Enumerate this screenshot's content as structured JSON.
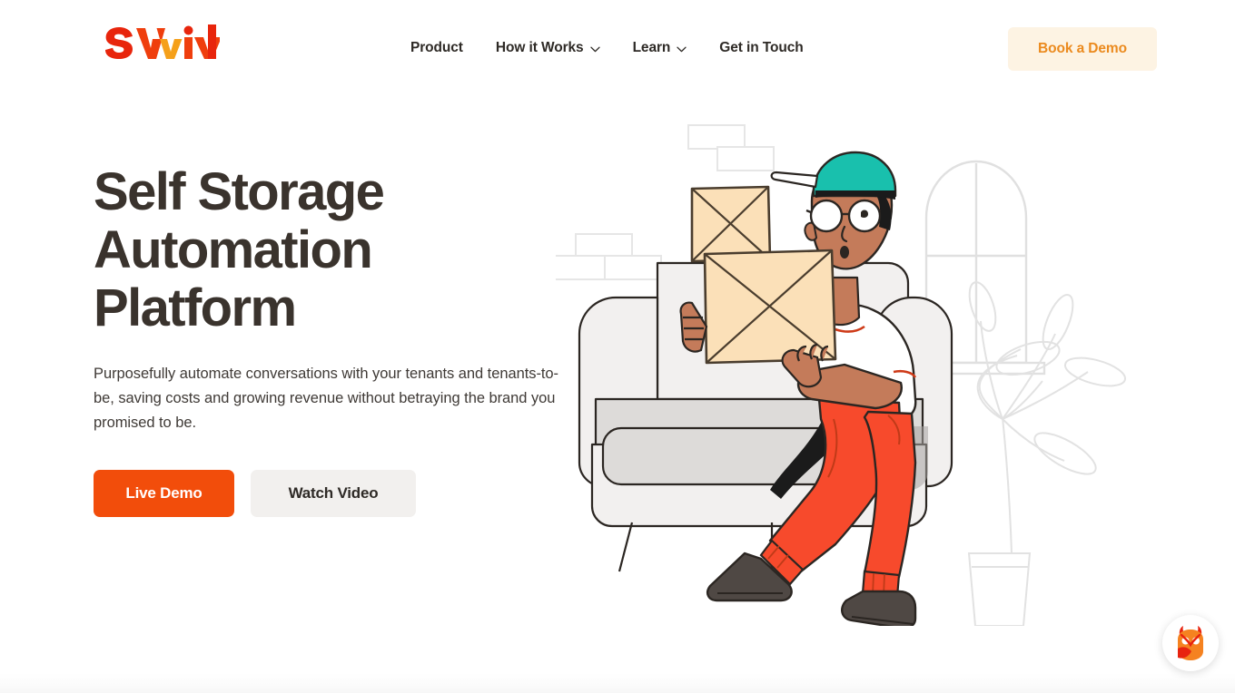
{
  "brand": {
    "logo_text": "swivl",
    "logo_colors": [
      "#e8250c",
      "#ee5a0b",
      "#f5a01a",
      "#ef3e0d",
      "#e8250c"
    ]
  },
  "header": {
    "nav_items": [
      {
        "label": "Product",
        "has_dropdown": false,
        "icon": ""
      },
      {
        "label": "How it Works",
        "has_dropdown": true,
        "icon": "chevron-down-icon"
      },
      {
        "label": "Learn",
        "has_dropdown": true,
        "icon": "chevron-down-icon"
      },
      {
        "label": "Get in Touch",
        "has_dropdown": false,
        "icon": ""
      }
    ],
    "cta": {
      "label": "Book a Demo",
      "bg": "#fdf3e3",
      "color": "#eb8a1e"
    }
  },
  "hero": {
    "headline": "Self Storage\nAutomation\nPlatform",
    "subhead": "Purposefully automate conversations with your tenants and tenants-to-be, saving costs and growing revenue without betraying the brand you promised to be.",
    "primary_button": {
      "label": "Live Demo",
      "bg": "#f24d0b",
      "color": "#ffffff"
    },
    "secondary_button": {
      "label": "Watch Video",
      "bg": "#f2f0ee",
      "color": "#2e2a26"
    }
  },
  "illustration": {
    "name": "person-carrying-boxes-on-sofa",
    "colors": {
      "cap": "#19c0ad",
      "skin": "#c47b5a",
      "shirt": "#ffffff",
      "pants": "#f74a2c",
      "shoes": "#4f4844",
      "box": "#fbe0b8",
      "box_outline": "#4a3d2e",
      "sofa": "#f2f0ef",
      "sofa_seat": "#dddbd9",
      "outline_light": "#e6e6e6",
      "line": "#2b2622"
    },
    "background_objects": [
      "brick-outline",
      "brick-outline",
      "arched-window-outline",
      "potted-plant-outline"
    ]
  },
  "chat_widget": {
    "name": "owl-chat-icon",
    "colors": {
      "body": "#f58220",
      "beak": "#e8230f",
      "eye": "#ffffff",
      "bg": "#ffffff"
    }
  },
  "colors": {
    "page_bg": "#ffffff",
    "text_dark": "#3a332d",
    "text_body": "#3f3a36",
    "accent_orange": "#f24d0b",
    "accent_amber": "#eb8a1e"
  }
}
